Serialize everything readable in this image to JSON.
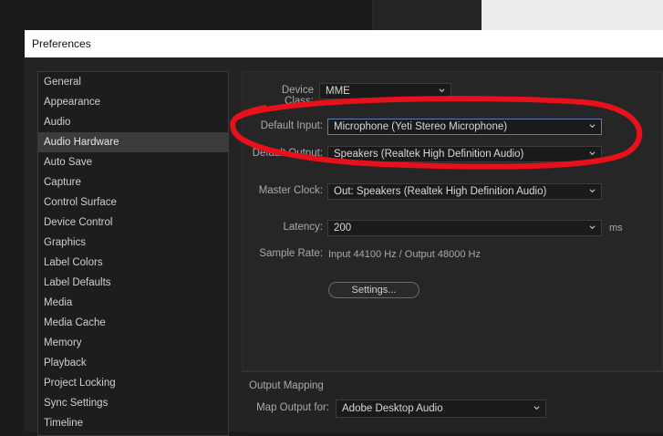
{
  "window": {
    "title": "Preferences"
  },
  "sidebar": {
    "items": [
      {
        "label": "General"
      },
      {
        "label": "Appearance"
      },
      {
        "label": "Audio"
      },
      {
        "label": "Audio Hardware",
        "selected": true
      },
      {
        "label": "Auto Save"
      },
      {
        "label": "Capture"
      },
      {
        "label": "Control Surface"
      },
      {
        "label": "Device Control"
      },
      {
        "label": "Graphics"
      },
      {
        "label": "Label Colors"
      },
      {
        "label": "Label Defaults"
      },
      {
        "label": "Media"
      },
      {
        "label": "Media Cache"
      },
      {
        "label": "Memory"
      },
      {
        "label": "Playback"
      },
      {
        "label": "Project Locking"
      },
      {
        "label": "Sync Settings"
      },
      {
        "label": "Timeline"
      }
    ]
  },
  "audio_hardware": {
    "device_class": {
      "label": "Device Class:",
      "value": "MME"
    },
    "default_input": {
      "label": "Default Input:",
      "value": "Microphone (Yeti Stereo Microphone)"
    },
    "default_output": {
      "label": "Default Output:",
      "value": "Speakers (Realtek High Definition Audio)"
    },
    "master_clock": {
      "label": "Master Clock:",
      "value": "Out: Speakers (Realtek High Definition Audio)"
    },
    "latency": {
      "label": "Latency:",
      "value": "200",
      "unit": "ms"
    },
    "sample_rate": {
      "label": "Sample Rate:",
      "value": "Input 44100 Hz / Output 48000 Hz"
    },
    "settings_button": "Settings..."
  },
  "output_mapping": {
    "title": "Output Mapping",
    "map_output_for": {
      "label": "Map Output for:",
      "value": "Adobe Desktop Audio"
    }
  },
  "annotation": {
    "color": "#e8101a",
    "shape": "hand-drawn-ellipse"
  },
  "icons": {
    "dropdown": "chevron-down-icon"
  }
}
